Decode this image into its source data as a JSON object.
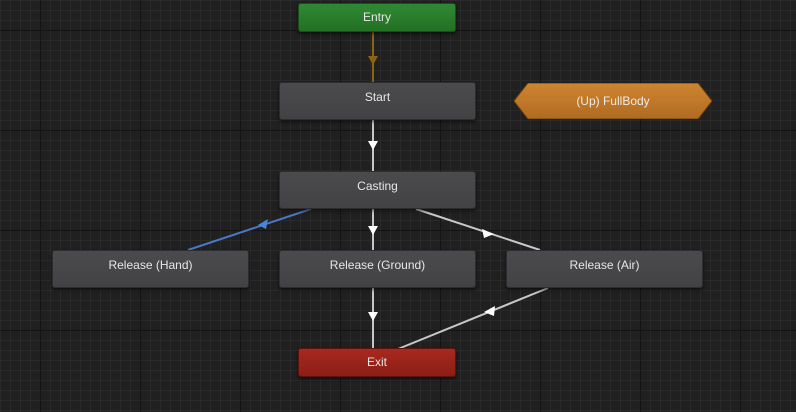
{
  "states": {
    "entry": "Entry",
    "start": "Start",
    "casting": "Casting",
    "release_hand": "Release (Hand)",
    "release_ground": "Release (Ground)",
    "release_air": "Release (Air)",
    "exit": "Exit"
  },
  "parent_state": {
    "label": "(Up) FullBody"
  },
  "colors": {
    "background": "#202020",
    "entry": "#2f8a34",
    "exit": "#a8291f",
    "state": "#4b4b4e",
    "parent_state": "#c27a2a",
    "transition": "#c8c8c8",
    "selected_transition": "#4a78c4",
    "entry_transition": "#8a6410"
  }
}
